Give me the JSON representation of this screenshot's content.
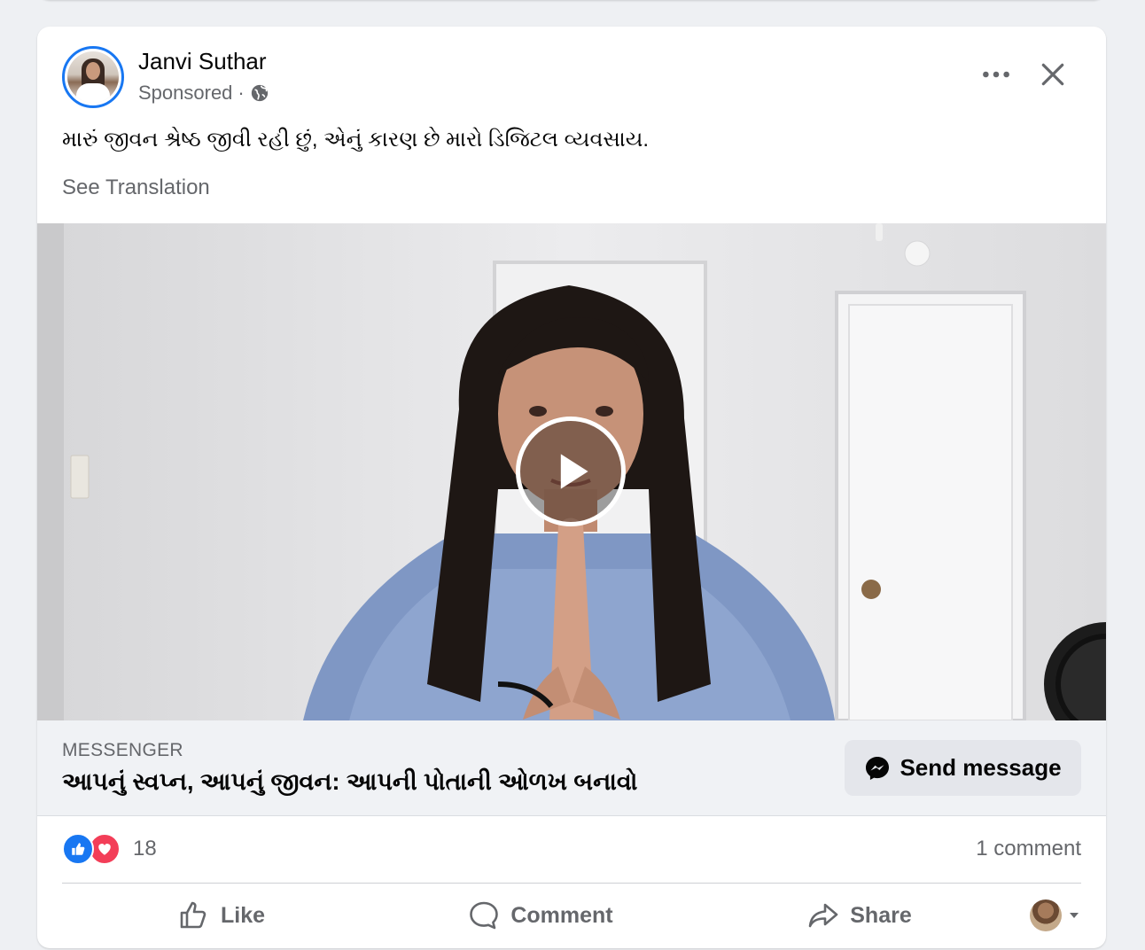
{
  "post": {
    "author": "Janvi Suthar",
    "sponsored_label": "Sponsored",
    "meta_separator": "·",
    "text": "મારું જીવન શ્રેષ્ઠ જીવી રહી છું, એનું કારણ છે મારો ડિજિટલ વ્યવસાય.",
    "see_translation": "See Translation"
  },
  "cta": {
    "source": "MESSENGER",
    "headline": "આપનું સ્વપ્ન, આપનું જીવન: આપની પોતાની ઓળખ બનાવો",
    "button_label": "Send message"
  },
  "stats": {
    "reaction_count": "18",
    "comments": "1 comment"
  },
  "actions": {
    "like": "Like",
    "comment": "Comment",
    "share": "Share"
  },
  "colors": {
    "accent": "#1877f2",
    "love": "#f33e58",
    "secondary_text": "#65676b"
  },
  "icons": [
    "globe-icon",
    "more-icon",
    "close-icon",
    "play-icon",
    "messenger-icon",
    "like-reaction-icon",
    "love-reaction-icon",
    "thumbs-up-icon",
    "comment-bubble-icon",
    "share-arrow-icon",
    "chevron-down-icon"
  ]
}
